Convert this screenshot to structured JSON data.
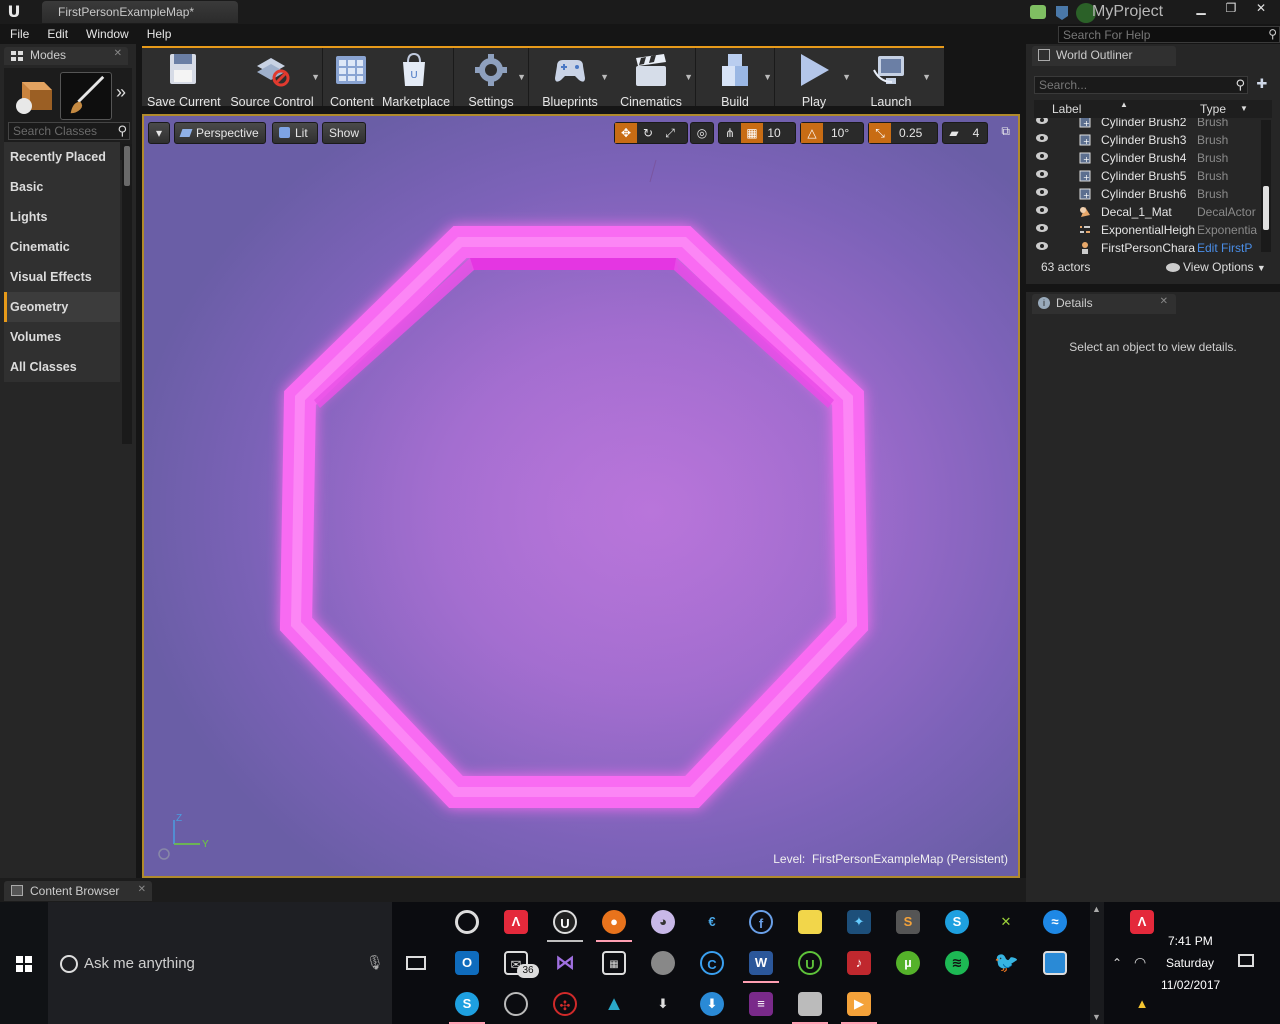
{
  "window": {
    "app_logo": "unreal-logo",
    "map_tab": "FirstPersonExampleMap*",
    "project_name": "MyProject",
    "help_search_placeholder": "Search For Help",
    "controls": [
      "minimize",
      "maximize",
      "close"
    ]
  },
  "menu": [
    "File",
    "Edit",
    "Window",
    "Help"
  ],
  "modes": {
    "tab_label": "Modes",
    "search_placeholder": "Search Classes",
    "categories": [
      "Recently Placed",
      "Basic",
      "Lights",
      "Cinematic",
      "Visual Effects",
      "Geometry",
      "Volumes",
      "All Classes"
    ],
    "selected_category": "Geometry"
  },
  "toolbar": {
    "buttons": [
      {
        "label": "Save Current",
        "icon": "floppy-disk-icon",
        "dropdown": false
      },
      {
        "label": "Source Control",
        "icon": "source-control-icon",
        "dropdown": true
      },
      {
        "label": "Content",
        "icon": "content-grid-icon",
        "dropdown": false
      },
      {
        "label": "Marketplace",
        "icon": "marketplace-bag-icon",
        "dropdown": false
      },
      {
        "label": "Settings",
        "icon": "settings-gear-icon",
        "dropdown": true
      },
      {
        "label": "Blueprints",
        "icon": "blueprints-gamepad-icon",
        "dropdown": true
      },
      {
        "label": "Cinematics",
        "icon": "clapper-icon",
        "dropdown": true
      },
      {
        "label": "Build",
        "icon": "build-blocks-icon",
        "dropdown": true
      },
      {
        "label": "Play",
        "icon": "play-triangle-icon",
        "dropdown": true
      },
      {
        "label": "Launch",
        "icon": "launch-monitor-icon",
        "dropdown": true
      }
    ]
  },
  "viewport": {
    "perspective": "Perspective",
    "lit": "Lit",
    "show": "Show",
    "grid_snap": "10",
    "rotation_snap": "10°",
    "scale_snap": "0.25",
    "camera_speed": "4",
    "level_prefix": "Level:",
    "level_name": "FirstPersonExampleMap (Persistent)",
    "axis_z": "Z",
    "axis_y": "Y",
    "glow_color": "#ff44ff"
  },
  "outliner": {
    "tab_label": "World Outliner",
    "search_placeholder": "Search...",
    "col_label": "Label",
    "col_type": "Type",
    "rows": [
      {
        "label": "Cylinder Brush2",
        "type": "Brush",
        "icon": "brush-icon"
      },
      {
        "label": "Cylinder Brush3",
        "type": "Brush",
        "icon": "brush-icon"
      },
      {
        "label": "Cylinder Brush4",
        "type": "Brush",
        "icon": "brush-icon"
      },
      {
        "label": "Cylinder Brush5",
        "type": "Brush",
        "icon": "brush-icon"
      },
      {
        "label": "Cylinder Brush6",
        "type": "Brush",
        "icon": "brush-icon"
      },
      {
        "label": "Decal_1_Mat",
        "type": "DecalActor",
        "icon": "decal-icon"
      },
      {
        "label": "ExponentialHeigh",
        "type": "Exponentia",
        "icon": "fog-icon"
      },
      {
        "label": "FirstPersonChara",
        "type": "Edit FirstP",
        "icon": "character-icon"
      }
    ],
    "actor_count": "63 actors",
    "view_options": "View Options"
  },
  "details": {
    "tab_label": "Details",
    "hint": "Select an object to view details."
  },
  "content_browser": {
    "tab_label": "Content Browser"
  },
  "taskbar": {
    "search_text": "Ask me anything",
    "mail_badge": "36",
    "time": "7:41 PM",
    "day": "Saturday",
    "date": "11/02/2017"
  }
}
